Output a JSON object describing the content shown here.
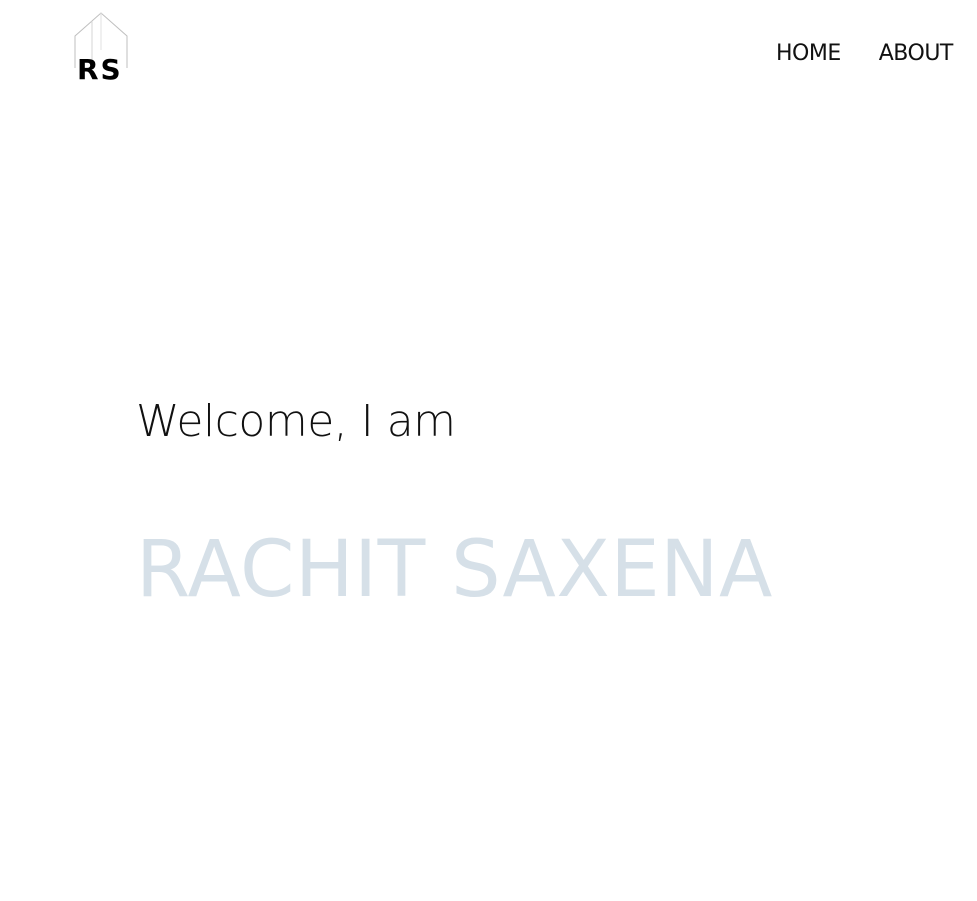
{
  "header": {
    "logo": {
      "text": "RS",
      "icon": "house-outline-icon"
    },
    "nav": {
      "items": [
        {
          "label": "HOME"
        },
        {
          "label": "ABOUT"
        }
      ]
    }
  },
  "hero": {
    "greeting": "Welcome, I am",
    "name": "RACHIT SAXENA"
  },
  "colors": {
    "text": "#111111",
    "name_text": "#d6e0e8",
    "background": "#ffffff",
    "logo_outline": "#bfbfbf"
  }
}
